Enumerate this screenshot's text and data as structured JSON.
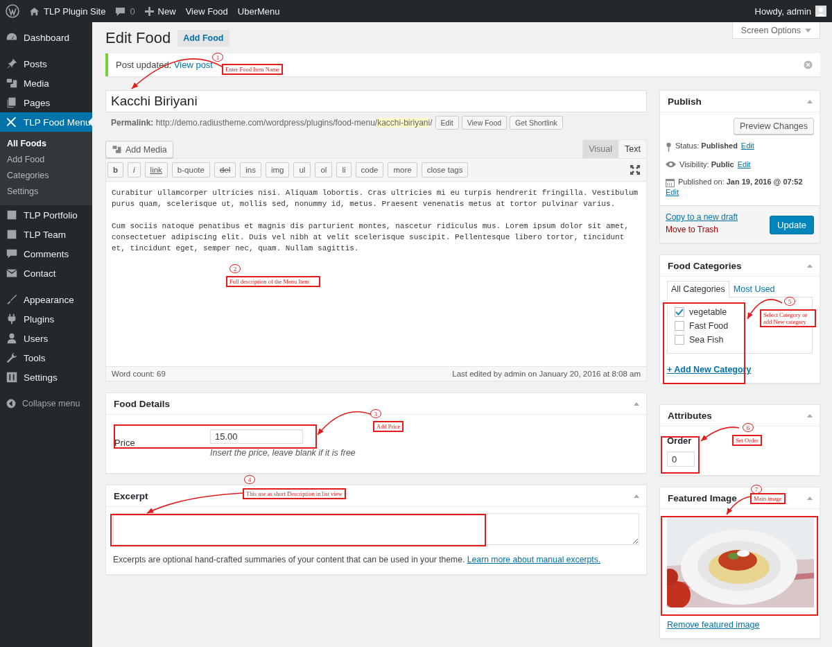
{
  "admin_bar": {
    "site": "TLP Plugin Site",
    "comments": "0",
    "new": "New",
    "links": [
      "View Food",
      "UberMenu"
    ],
    "greeting": "Howdy, admin"
  },
  "sidebar": {
    "groups": [
      {
        "items": [
          {
            "label": "Dashboard",
            "selected": false
          }
        ]
      },
      {
        "items": [
          {
            "label": "Posts",
            "selected": false
          },
          {
            "label": "Media",
            "selected": false
          },
          {
            "label": "Pages",
            "selected": false
          },
          {
            "label": "TLP Food Menu",
            "selected": true,
            "children": [
              {
                "label": "All Foods",
                "selected": true
              },
              {
                "label": "Add Food",
                "selected": false
              },
              {
                "label": "Categories",
                "selected": false
              },
              {
                "label": "Settings",
                "selected": false
              }
            ]
          },
          {
            "label": "TLP Portfolio",
            "selected": false
          },
          {
            "label": "TLP Team",
            "selected": false
          },
          {
            "label": "Comments",
            "selected": false
          },
          {
            "label": "Contact",
            "selected": false
          }
        ]
      },
      {
        "items": [
          {
            "label": "Appearance",
            "selected": false
          },
          {
            "label": "Plugins",
            "selected": false
          },
          {
            "label": "Users",
            "selected": false
          },
          {
            "label": "Tools",
            "selected": false
          },
          {
            "label": "Settings",
            "selected": false
          }
        ]
      }
    ],
    "collapse": "Collapse menu"
  },
  "screen_options": "Screen Options",
  "page": {
    "title": "Edit Food",
    "add_button": "Add Food"
  },
  "notice": {
    "text": "Post updated.",
    "link": "View post"
  },
  "post_title": "Kacchi Biriyani",
  "permalink": {
    "label": "Permalink:",
    "base": "http://demo.radiustheme.com/wordpress/plugins/food-menu/",
    "slug": "kacchi-biriyani",
    "end": "/",
    "buttons": [
      "Edit",
      "View Food",
      "Get Shortlink"
    ]
  },
  "editor": {
    "add_media": "Add Media",
    "tabs": [
      {
        "label": "Visual",
        "selected": false
      },
      {
        "label": "Text",
        "selected": true
      }
    ],
    "toolbar": [
      {
        "label": "b",
        "kind": "bold"
      },
      {
        "label": "i",
        "kind": "italic"
      },
      {
        "label": "link",
        "kind": "link"
      },
      {
        "label": "b-quote",
        "kind": "plain"
      },
      {
        "label": "del",
        "kind": "del"
      },
      {
        "label": "ins",
        "kind": "plain"
      },
      {
        "label": "img",
        "kind": "plain"
      },
      {
        "label": "ul",
        "kind": "plain"
      },
      {
        "label": "ol",
        "kind": "plain"
      },
      {
        "label": "li",
        "kind": "plain"
      },
      {
        "label": "code",
        "kind": "plain"
      },
      {
        "label": "more",
        "kind": "plain"
      },
      {
        "label": "close tags",
        "kind": "plain"
      }
    ],
    "paragraphs": [
      "Curabitur ullamcorper ultricies nisi. Aliquam lobortis. Cras ultricies mi eu turpis hendrerit fringilla. Vestibulum purus quam, scelerisque ut, mollis sed, nonummy id, metus. Praesent venenatis metus at tortor pulvinar varius.",
      "Cum sociis natoque penatibus et magnis dis parturient montes, nascetur ridiculus mus. Lorem ipsum dolor sit amet, consectetuer adipiscing elit. Duis vel nibh at velit scelerisque suscipit. Pellentesque libero tortor, tincidunt et, tincidunt eget, semper nec, quam. Nullam sagittis."
    ],
    "word_count": "Word count: 69",
    "last_edited": "Last edited by admin on January 20, 2016 at 8:08 am"
  },
  "food_details": {
    "title": "Food Details",
    "label": "Price",
    "value": "15.00",
    "hint": "Insert the price, leave blank if it is free"
  },
  "excerpt": {
    "title": "Excerpt",
    "note": "Excerpts are optional hand-crafted summaries of your content that can be used in your theme.",
    "link": "Learn more about manual excerpts."
  },
  "publish": {
    "title": "Publish",
    "preview": "Preview Changes",
    "rows": [
      {
        "text": "Status: **Published**",
        "link": "Edit"
      },
      {
        "text": "Visibility: **Public**",
        "link": "Edit"
      },
      {
        "text": "Published on: **Jan 19, 2016 @ 07:52**",
        "link": "Edit"
      }
    ],
    "copy": "Copy to a new draft",
    "trash": "Move to Trash",
    "update": "Update"
  },
  "categories": {
    "title": "Food Categories",
    "tabs": [
      {
        "label": "All Categories",
        "selected": true
      },
      {
        "label": "Most Used",
        "selected": false
      }
    ],
    "items": [
      {
        "label": "vegetable",
        "checked": true
      },
      {
        "label": "Fast Food",
        "checked": false
      },
      {
        "label": "Sea Fish",
        "checked": false
      }
    ],
    "add": "+ Add New Category"
  },
  "attributes": {
    "title": "Attributes",
    "label": "Order",
    "value": "0"
  },
  "featured": {
    "title": "Featured Image",
    "remove": "Remove featured image"
  },
  "annotations": [
    {
      "number": "1",
      "label": "Enter Food Item Name"
    },
    {
      "number": "2",
      "label": "Full description of the Menu Item"
    },
    {
      "number": "3",
      "label": "Add Price"
    },
    {
      "number": "4",
      "label": "This use as short Description in list view"
    },
    {
      "number": "5",
      "label": "Select Category or add New category"
    },
    {
      "number": "6",
      "label": "Set Order"
    },
    {
      "number": "7",
      "label": "Main image"
    }
  ]
}
